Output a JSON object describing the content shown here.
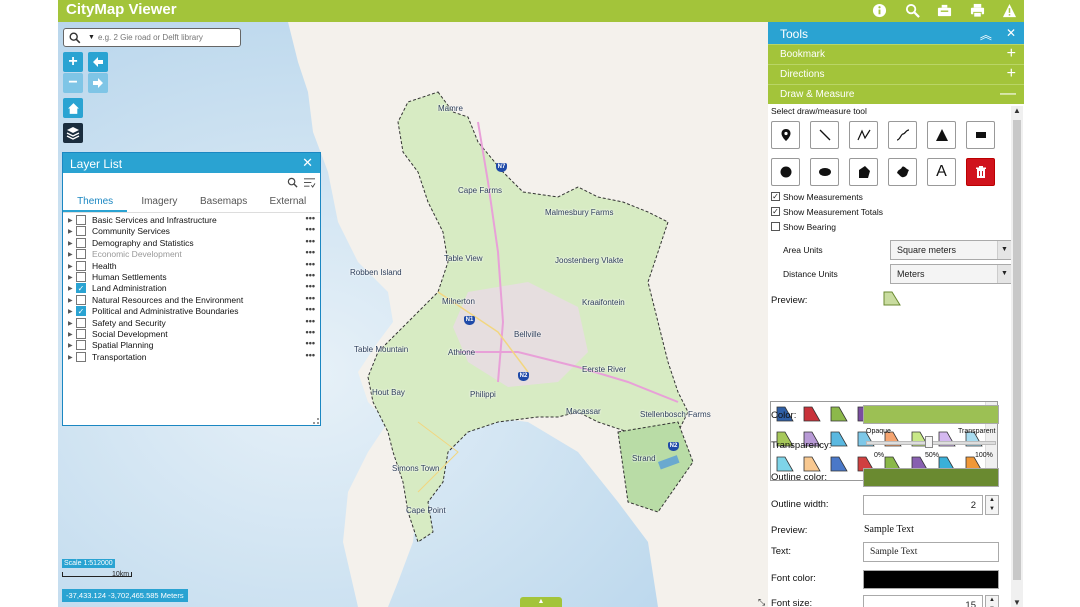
{
  "app": {
    "title": "CityMap Viewer"
  },
  "topbar": {
    "icons": [
      "info-icon",
      "search-icon",
      "tools-icon",
      "print-icon",
      "warning-icon"
    ]
  },
  "search": {
    "placeholder": "e.g. 2 Gie road or Delft library"
  },
  "map": {
    "place_labels": [
      "Mamre",
      "Cape Farms",
      "Malmesbury Farms",
      "Table View",
      "Robben Island",
      "Joostenberg Vlakte",
      "Milnerton",
      "Kraaifontein",
      "Bellville",
      "Table Mountain",
      "Athlone",
      "Eerste River",
      "Hout Bay",
      "Philippi",
      "Macassar",
      "Stellenbosch Farms",
      "Strand",
      "Simons Town",
      "Cape Point"
    ],
    "route_shields": [
      "N7",
      "N1",
      "N2",
      "N2"
    ],
    "scale_label": "Scale 1:512000",
    "scale_bar_label": "10km",
    "coordinates": "-37,433.124 -3,702,465.585 Meters"
  },
  "layer_list": {
    "title": "Layer List",
    "tabs": [
      "Themes",
      "Imagery",
      "Basemaps",
      "External"
    ],
    "active_tab": "Themes",
    "layers": [
      {
        "label": "Basic Services and Infrastructure",
        "checked": false,
        "dim": false
      },
      {
        "label": "Community Services",
        "checked": false,
        "dim": false
      },
      {
        "label": "Demography and Statistics",
        "checked": false,
        "dim": false
      },
      {
        "label": "Economic Development",
        "checked": false,
        "dim": true
      },
      {
        "label": "Health",
        "checked": false,
        "dim": false
      },
      {
        "label": "Human Settlements",
        "checked": false,
        "dim": false
      },
      {
        "label": "Land Administration",
        "checked": true,
        "dim": false
      },
      {
        "label": "Natural Resources and the Environment",
        "checked": false,
        "dim": false
      },
      {
        "label": "Political and Administrative Boundaries",
        "checked": true,
        "dim": false
      },
      {
        "label": "Safety and Security",
        "checked": false,
        "dim": false
      },
      {
        "label": "Social Development",
        "checked": false,
        "dim": false
      },
      {
        "label": "Spatial Planning",
        "checked": false,
        "dim": false
      },
      {
        "label": "Transportation",
        "checked": false,
        "dim": false
      }
    ],
    "more_label": "•••"
  },
  "tools": {
    "title": "Tools",
    "sections": [
      {
        "label": "Bookmark",
        "toggle": "+"
      },
      {
        "label": "Directions",
        "toggle": "+"
      },
      {
        "label": "Draw & Measure",
        "toggle": "—"
      }
    ],
    "select_label": "Select draw/measure tool",
    "draw_tools": [
      "point-icon",
      "line-icon",
      "polyline-icon",
      "freehand-polyline-icon",
      "triangle-icon",
      "rectangle-icon",
      "circle-icon",
      "ellipse-icon",
      "polygon-icon",
      "freehand-polygon-icon",
      "text-icon",
      "delete-icon"
    ],
    "show_measurements": {
      "label": "Show Measurements",
      "checked": true
    },
    "show_totals": {
      "label": "Show Measurement Totals",
      "checked": true
    },
    "show_bearing": {
      "label": "Show Bearing",
      "checked": false
    },
    "area_units": {
      "label": "Area Units",
      "value": "Square meters"
    },
    "distance_units": {
      "label": "Distance Units",
      "value": "Meters"
    },
    "preview_label": "Preview:",
    "palette_colors": [
      "#2f5fa6",
      "#c8323a",
      "#8cb84a",
      "#7a4ea0",
      "#2aa3d2",
      "#f08a24",
      "#4a90d2",
      "#e07a80",
      "#a6c85a",
      "#b89ad6",
      "#5ab8e0",
      "#7ec8e8",
      "#f4a470",
      "#c8e888",
      "#d4b8f0",
      "#a8dcf0",
      "#7ed4e8",
      "#f8c890",
      "#4a78c8",
      "#d04040",
      "#8ab848",
      "#8860b0",
      "#3ab0d8",
      "#f09838"
    ],
    "color_label": "Color:",
    "fill_color": "#9cc054",
    "transparency_label": "Transparency:",
    "transparency": {
      "left": "Opaque",
      "right": "Transparent",
      "ticks": [
        "0%",
        "50%",
        "100%"
      ],
      "value": 0.5
    },
    "outline_color_label": "Outline color:",
    "outline_color": "#6a8a30",
    "outline_width_label": "Outline width:",
    "outline_width": "2",
    "text_preview_label": "Preview:",
    "text_preview": "Sample Text",
    "text_label": "Text:",
    "text_value": "Sample Text",
    "font_color_label": "Font color:",
    "font_color": "#000000",
    "font_size_label": "Font size:",
    "font_size": "15"
  }
}
